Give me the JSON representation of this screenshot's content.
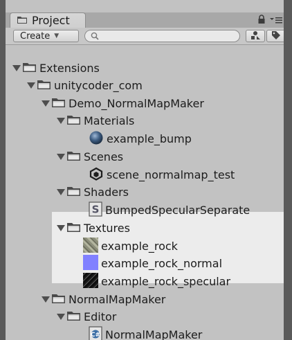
{
  "window": {
    "tab_label": "Project",
    "create_label": "Create",
    "search_placeholder": "",
    "icons": [
      "folder-icon",
      "lock-icon",
      "menu-icon",
      "search-icon",
      "label-filter-icon",
      "tag-icon",
      "caret-down-icon"
    ]
  },
  "tree": {
    "items": [
      {
        "label": "Extensions",
        "type": "folder",
        "expanded": true
      },
      {
        "label": "unitycoder_com",
        "type": "folder",
        "expanded": true
      },
      {
        "label": "Demo_NormalMapMaker",
        "type": "folder",
        "expanded": true
      },
      {
        "label": "Materials",
        "type": "folder",
        "expanded": true
      },
      {
        "label": "example_bump",
        "type": "material"
      },
      {
        "label": "Scenes",
        "type": "folder",
        "expanded": true
      },
      {
        "label": "scene_normalmap_test",
        "type": "scene"
      },
      {
        "label": "Shaders",
        "type": "folder",
        "expanded": true
      },
      {
        "label": "BumpedSpecularSeparate",
        "type": "shader"
      },
      {
        "label": "Textures",
        "type": "folder",
        "expanded": true
      },
      {
        "label": "example_rock",
        "type": "texture"
      },
      {
        "label": "example_rock_normal",
        "type": "texture"
      },
      {
        "label": "example_rock_specular",
        "type": "texture"
      },
      {
        "label": "NormalMapMaker",
        "type": "folder",
        "expanded": true
      },
      {
        "label": "Editor",
        "type": "folder",
        "expanded": true
      },
      {
        "label": "NormalMapMaker",
        "type": "csharp-script"
      }
    ]
  },
  "colors": {
    "panel_bg": "#c2c2c2",
    "selection_bg": "#efefef",
    "normal_map_color": "#8080ff"
  }
}
